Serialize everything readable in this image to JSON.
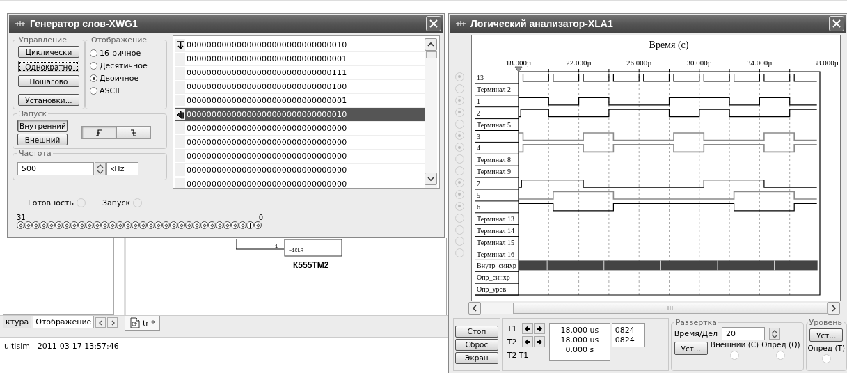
{
  "workspace": {
    "left_tabs": [
      {
        "label": "ктура",
        "selected": false
      },
      {
        "label": "Отображение",
        "selected": true
      }
    ],
    "component": {
      "name": "К555ТМ2",
      "pin_label": "~1CLR",
      "pin_number": "1"
    },
    "document_tabs": [
      {
        "label": "tr *",
        "selected": true
      }
    ],
    "status": "ultisim - 2011-03-17 13:57:46"
  },
  "word_generator": {
    "title": "Генератор слов-XWG1",
    "control": {
      "label": "Управление",
      "buttons": [
        {
          "label": "Циклически",
          "selected": false
        },
        {
          "label": "Однократно",
          "selected": true
        },
        {
          "label": "Пошагово",
          "selected": false
        },
        {
          "label": "Установки...",
          "selected": false
        }
      ]
    },
    "display": {
      "label": "Отображение",
      "options": [
        {
          "label": "16-ричное",
          "selected": false
        },
        {
          "label": "Десятичное",
          "selected": false
        },
        {
          "label": "Двоичное",
          "selected": true
        },
        {
          "label": "ASCII",
          "selected": false
        }
      ]
    },
    "trigger": {
      "label": "Запуск",
      "buttons": [
        {
          "label": "Внутренний",
          "selected": true
        },
        {
          "label": "Внешний",
          "selected": false
        }
      ],
      "edges": [
        {
          "kind": "rising",
          "selected": true
        },
        {
          "kind": "falling",
          "selected": false
        }
      ]
    },
    "frequency": {
      "label": "Частота",
      "value": "500",
      "unit": "kHz"
    },
    "words": [
      {
        "value": "00000000000000000000000000000010",
        "selected": false,
        "initial": true
      },
      {
        "value": "00000000000000000000000000000001",
        "selected": false
      },
      {
        "value": "00000000000000000000000000000111",
        "selected": false
      },
      {
        "value": "00000000000000000000000000000100",
        "selected": false
      },
      {
        "value": "00000000000000000000000000000001",
        "selected": false
      },
      {
        "value": "00000000000000000000000000000010",
        "selected": true,
        "initial": false
      },
      {
        "value": "00000000000000000000000000000000",
        "selected": false
      },
      {
        "value": "00000000000000000000000000000000",
        "selected": false
      },
      {
        "value": "00000000000000000000000000000000",
        "selected": false
      },
      {
        "value": "00000000000000000000000000000000",
        "selected": false
      },
      {
        "value": "00000000000000000000000000000000",
        "selected": false
      }
    ],
    "status": [
      {
        "label": "Готовность",
        "on": false
      },
      {
        "label": "Запуск",
        "on": false
      }
    ],
    "bit_range": {
      "high": "31",
      "low": "0"
    },
    "bits": [
      {
        "on": false
      },
      {
        "on": false
      },
      {
        "on": false
      },
      {
        "on": false
      },
      {
        "on": false
      },
      {
        "on": false
      },
      {
        "on": false
      },
      {
        "on": false
      },
      {
        "on": false
      },
      {
        "on": false
      },
      {
        "on": false
      },
      {
        "on": false
      },
      {
        "on": false
      },
      {
        "on": false
      },
      {
        "on": false
      },
      {
        "on": false
      },
      {
        "on": false
      },
      {
        "on": false
      },
      {
        "on": false
      },
      {
        "on": false
      },
      {
        "on": false
      },
      {
        "on": false
      },
      {
        "on": false
      },
      {
        "on": false
      },
      {
        "on": false
      },
      {
        "on": false
      },
      {
        "on": false
      },
      {
        "on": false
      },
      {
        "on": false
      },
      {
        "on": false
      },
      {
        "on": true
      },
      {
        "on": false
      }
    ]
  },
  "logic_analyzer": {
    "title": "Логический анализатор-XLA1",
    "time_axis": {
      "title": "Время (с)",
      "ticks": [
        "18.000µ",
        "22.000µ",
        "26.000µ",
        "30.000µ",
        "34.000µ",
        "38.000µ"
      ]
    },
    "channels": [
      {
        "label": "13",
        "kind": "channel",
        "connected": true
      },
      {
        "label": "Терминал 2",
        "kind": "channel",
        "connected": false
      },
      {
        "label": "1",
        "kind": "channel",
        "connected": true
      },
      {
        "label": "2",
        "kind": "channel",
        "connected": true
      },
      {
        "label": "Терминал 5",
        "kind": "channel",
        "connected": false
      },
      {
        "label": "3",
        "kind": "channel",
        "connected": true
      },
      {
        "label": "4",
        "kind": "channel",
        "connected": true
      },
      {
        "label": "Терминал 8",
        "kind": "channel",
        "connected": false
      },
      {
        "label": "Терминал 9",
        "kind": "channel",
        "connected": false
      },
      {
        "label": "7",
        "kind": "channel",
        "connected": true
      },
      {
        "label": "5",
        "kind": "channel",
        "connected": true
      },
      {
        "label": "6",
        "kind": "channel",
        "connected": true
      },
      {
        "label": "Терминал 13",
        "kind": "channel",
        "connected": false
      },
      {
        "label": "Терминал 14",
        "kind": "channel",
        "connected": false
      },
      {
        "label": "Терминал 15",
        "kind": "channel",
        "connected": false
      },
      {
        "label": "Терминал 16",
        "kind": "channel",
        "connected": false
      },
      {
        "label": "Внутр_синхр",
        "kind": "trigger"
      },
      {
        "label": "Опр_синхр",
        "kind": "trigger"
      },
      {
        "label": "Опр_уров",
        "kind": "trigger"
      }
    ],
    "buttons": [
      "Стоп",
      "Сброс",
      "Экран"
    ],
    "cursors": [
      {
        "label": "T1",
        "time": "18.000 us",
        "value": "0824"
      },
      {
        "label": "T2",
        "time": "18.000 us",
        "value": "0824"
      },
      {
        "label": "T2-T1",
        "time": "0.000 s"
      }
    ],
    "timebase": {
      "label": "Развертка",
      "field_label": "Время/Дел",
      "value": "20",
      "button": "Уст...",
      "options": [
        {
          "label": "Внешний (C)",
          "selected": false
        },
        {
          "label": "Опред (Q)",
          "selected": false
        }
      ]
    },
    "level": {
      "label": "Уровень",
      "button": "Уст...",
      "options": [
        {
          "label": "Опред (T)",
          "selected": false
        }
      ]
    }
  }
}
